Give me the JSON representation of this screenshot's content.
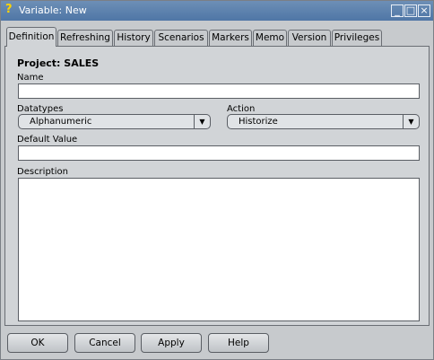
{
  "window": {
    "title": "Variable: New",
    "icon": "question-icon"
  },
  "tabs": [
    {
      "label": "Definition"
    },
    {
      "label": "Refreshing"
    },
    {
      "label": "History"
    },
    {
      "label": "Scenarios"
    },
    {
      "label": "Markers"
    },
    {
      "label": "Memo"
    },
    {
      "label": "Version"
    },
    {
      "label": "Privileges"
    }
  ],
  "form": {
    "project_label": "Project: SALES",
    "name_label": "Name",
    "name_value": "",
    "datatypes_label": "Datatypes",
    "datatypes_value": "Alphanumeric",
    "action_label": "Action",
    "action_value": "Historize",
    "default_value_label": "Default Value",
    "default_value": "",
    "description_label": "Description",
    "description_value": ""
  },
  "buttons": {
    "ok": "OK",
    "cancel": "Cancel",
    "apply": "Apply",
    "help": "Help"
  }
}
